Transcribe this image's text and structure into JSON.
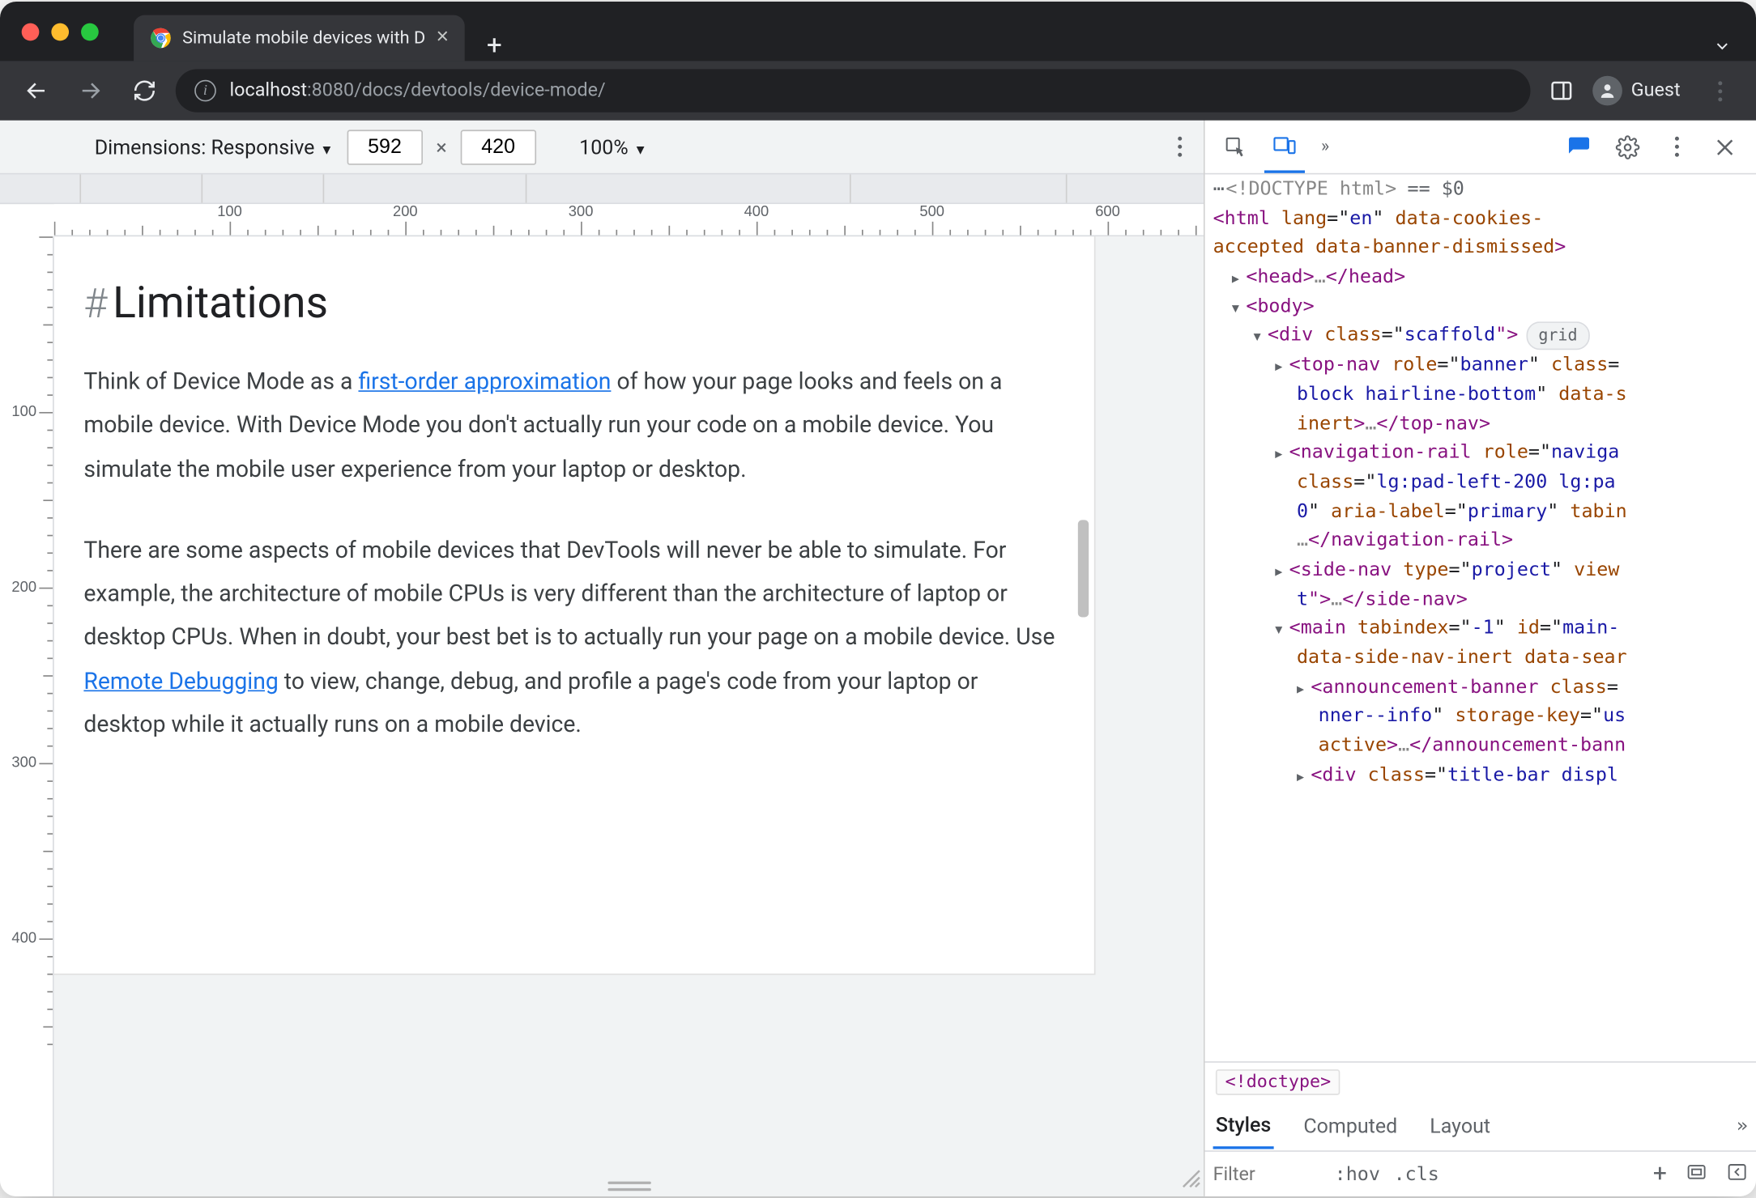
{
  "browser": {
    "tab_title": "Simulate mobile devices with D",
    "url_prefix": "localhost",
    "url_port": ":8080",
    "url_path": "/docs/devtools/device-mode/",
    "guest_label": "Guest"
  },
  "device_toolbar": {
    "label": "Dimensions: Responsive",
    "width": "592",
    "times": "×",
    "height": "420",
    "zoom": "100%"
  },
  "page": {
    "heading": "Limitations",
    "para1_a": "Think of Device Mode as a ",
    "para1_link": "first-order approximation",
    "para1_b": " of how your page looks and feels on a mobile device. With Device Mode you don't actually run your code on a mobile device. You simulate the mobile user experience from your laptop or desktop.",
    "para2_a": "There are some aspects of mobile devices that DevTools will never be able to simulate. For example, the architecture of mobile CPUs is very different than the architecture of laptop or desktop CPUs. When in doubt, your best bet is to actually run your page on a mobile device. Use ",
    "para2_link": "Remote Debugging",
    "para2_b": " to view, change, debug, and profile a page's code from your laptop or desktop while it actually runs on a mobile device."
  },
  "devtools": {
    "doctype": "<!DOCTYPE html>",
    "eq_zero": "== $0",
    "grid_pill": "grid",
    "breadcrumb": "<!doctype>",
    "tabs": {
      "styles": "Styles",
      "computed": "Computed",
      "layout": "Layout"
    },
    "filter_placeholder": "Filter",
    "hov": ":hov",
    "cls": ".cls",
    "dom_l1": {
      "a": "<html ",
      "b": "lang",
      "c": "=\"",
      "d": "en",
      "e": "\" ",
      "f": "data-cookies-"
    },
    "dom_l1c": {
      "a": "accepted",
      "b": " data-banner-dismissed",
      "c": ">"
    },
    "dom_head": {
      "a": "<head>",
      "b": "…",
      "c": "</head>"
    },
    "dom_body": "<body>",
    "dom_div": {
      "a": "<div ",
      "b": "class",
      "c": "=\"",
      "d": "scaffold",
      "e": "\">"
    },
    "dom_top1": {
      "a": "<top-nav ",
      "b": "role",
      "c": "=\"",
      "d": "banner",
      "e": "\" ",
      "f": "class",
      "g": "="
    },
    "dom_top2": {
      "a": "block hairline-bottom",
      "b": "\" ",
      "c": "data-s"
    },
    "dom_top3": {
      "a": "inert",
      "b": ">",
      "c": "…",
      "d": "</top-nav>"
    },
    "dom_nav1": {
      "a": "<navigation-rail ",
      "b": "role",
      "c": "=\"",
      "d": "naviga"
    },
    "dom_nav2": {
      "a": "class",
      "b": "=\"",
      "c": "lg:pad-left-200 lg:pa"
    },
    "dom_nav3": {
      "a": "0",
      "b": "\" ",
      "c": "aria-label",
      "d": "=\"",
      "e": "primary",
      "f": "\" ",
      "g": "tabin"
    },
    "dom_nav4": {
      "a": "…",
      "b": "</navigation-rail>"
    },
    "dom_side1": {
      "a": "<side-nav ",
      "b": "type",
      "c": "=\"",
      "d": "project",
      "e": "\" ",
      "f": "view"
    },
    "dom_side2": {
      "a": "t",
      "b": "\">",
      "c": "…",
      "d": "</side-nav>"
    },
    "dom_main1": {
      "a": "<main ",
      "b": "tabindex",
      "c": "=\"",
      "d": "-1",
      "e": "\" ",
      "f": "id",
      "g": "=\"",
      "h": "main-"
    },
    "dom_main2": {
      "a": "data-side-nav-inert",
      "b": " data-sear"
    },
    "dom_ann1": {
      "a": "<announcement-banner ",
      "b": "class",
      "c": "="
    },
    "dom_ann2": {
      "a": "nner--info",
      "b": "\" ",
      "c": "storage-key",
      "d": "=\"",
      "e": "us"
    },
    "dom_ann3": {
      "a": "active",
      "b": ">",
      "c": "…",
      "d": "</announcement-bann"
    },
    "dom_title": {
      "a": "<div ",
      "b": "class",
      "c": "=\"",
      "d": "title-bar displ"
    }
  }
}
